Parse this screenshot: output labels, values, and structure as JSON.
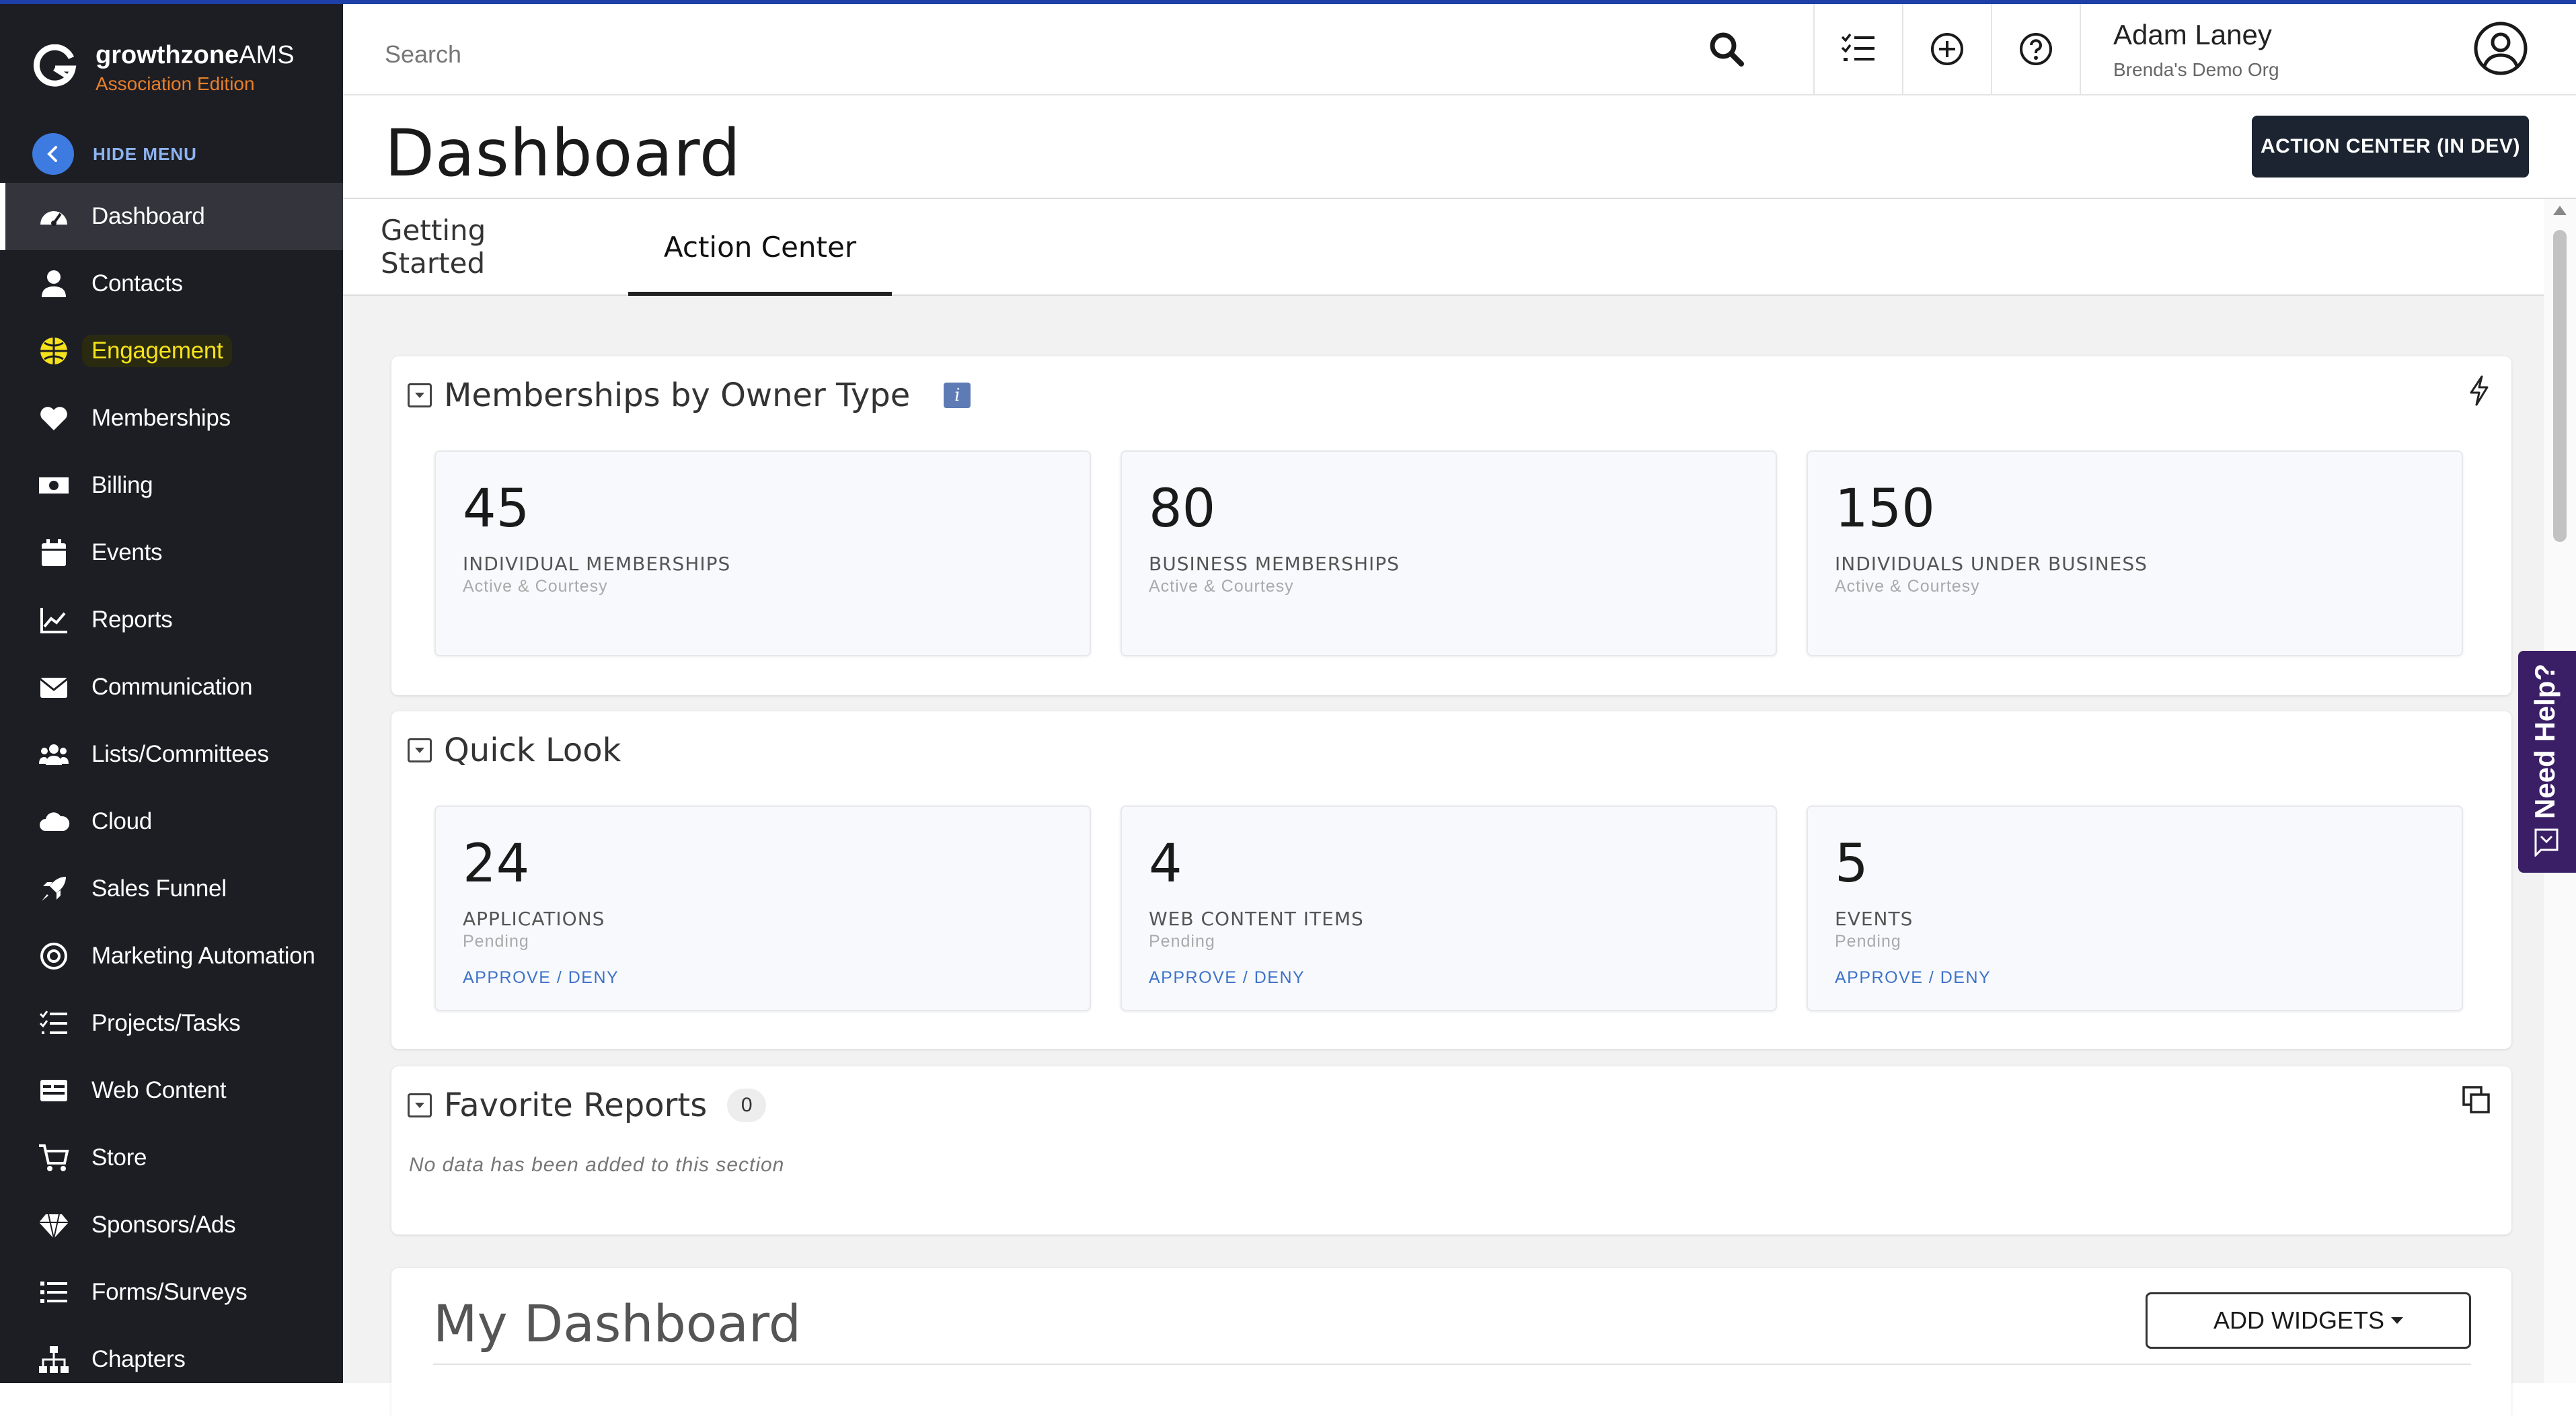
{
  "brand": {
    "name_bold": "growthzone",
    "name_rest": "AMS",
    "edition": "Association Edition"
  },
  "sidebar": {
    "hide_menu": "HIDE MENU",
    "items": [
      {
        "label": "Dashboard",
        "icon": "dashboard-gauge-icon"
      },
      {
        "label": "Contacts",
        "icon": "person-icon"
      },
      {
        "label": "Engagement",
        "icon": "globe-icon"
      },
      {
        "label": "Memberships",
        "icon": "heart-icon"
      },
      {
        "label": "Billing",
        "icon": "money-bill-icon"
      },
      {
        "label": "Events",
        "icon": "calendar-icon"
      },
      {
        "label": "Reports",
        "icon": "line-chart-icon"
      },
      {
        "label": "Communication",
        "icon": "envelope-icon"
      },
      {
        "label": "Lists/Committees",
        "icon": "users-icon"
      },
      {
        "label": "Cloud",
        "icon": "cloud-icon"
      },
      {
        "label": "Sales Funnel",
        "icon": "rocket-icon"
      },
      {
        "label": "Marketing Automation",
        "icon": "bullseye-icon"
      },
      {
        "label": "Projects/Tasks",
        "icon": "task-list-icon"
      },
      {
        "label": "Web Content",
        "icon": "web-content-icon"
      },
      {
        "label": "Store",
        "icon": "cart-icon"
      },
      {
        "label": "Sponsors/Ads",
        "icon": "gem-icon"
      },
      {
        "label": "Forms/Surveys",
        "icon": "list-icon"
      },
      {
        "label": "Chapters",
        "icon": "sitemap-icon"
      }
    ]
  },
  "header": {
    "search_placeholder": "Search",
    "user_name": "Adam Laney",
    "user_org": "Brenda's Demo Org"
  },
  "page": {
    "title": "Dashboard",
    "action_button": "ACTION CENTER (IN DEV)",
    "tabs": [
      "Getting Started",
      "Action Center"
    ],
    "active_tab": "Action Center"
  },
  "memberships": {
    "title": "Memberships by Owner Type",
    "info": "i",
    "cards": [
      {
        "value": "45",
        "label": "INDIVIDUAL MEMBERSHIPS",
        "sub": "Active & Courtesy"
      },
      {
        "value": "80",
        "label": "BUSINESS MEMBERSHIPS",
        "sub": "Active & Courtesy"
      },
      {
        "value": "150",
        "label": "INDIVIDUALS UNDER BUSINESS",
        "sub": "Active & Courtesy"
      }
    ]
  },
  "quick_look": {
    "title": "Quick Look",
    "cards": [
      {
        "value": "24",
        "label": "APPLICATIONS",
        "sub": "Pending",
        "link": "APPROVE / DENY"
      },
      {
        "value": "4",
        "label": "WEB CONTENT ITEMS",
        "sub": "Pending",
        "link": "APPROVE / DENY"
      },
      {
        "value": "5",
        "label": "EVENTS",
        "sub": "Pending",
        "link": "APPROVE / DENY"
      }
    ]
  },
  "favorite_reports": {
    "title": "Favorite Reports",
    "count": "0",
    "empty_text": "No data has been added to this section"
  },
  "my_dashboard": {
    "title": "My Dashboard",
    "add_widgets": "ADD WIDGETS"
  },
  "need_help": "Need Help?",
  "colors": {
    "sidebar_bg": "#1d1e24",
    "accent_blue": "#3d7be0",
    "brand_orange": "#e97f2a",
    "highlight_yellow": "#f5e21b",
    "help_purple": "#3b1f66"
  }
}
